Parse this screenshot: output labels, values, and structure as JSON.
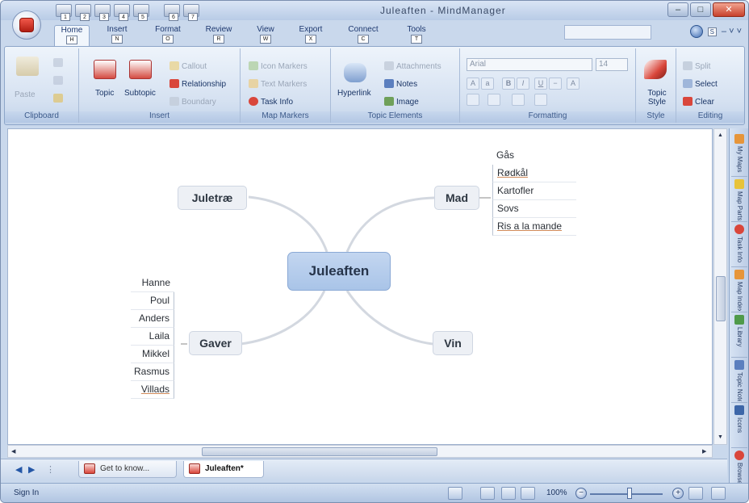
{
  "window": {
    "title": "Juleaften - MindManager",
    "controls": [
      "–",
      "□",
      "✕"
    ]
  },
  "quick_access": {
    "keys": [
      "1",
      "2",
      "3",
      "4",
      "5",
      "6",
      "7"
    ]
  },
  "ribbon_tabs": [
    {
      "label": "Home",
      "key": "H",
      "active": true
    },
    {
      "label": "Insert",
      "key": "N"
    },
    {
      "label": "Format",
      "key": "O"
    },
    {
      "label": "Review",
      "key": "R"
    },
    {
      "label": "View",
      "key": "W"
    },
    {
      "label": "Export",
      "key": "X"
    },
    {
      "label": "Connect",
      "key": "C"
    },
    {
      "label": "Tools",
      "key": "T"
    }
  ],
  "help_key": "S",
  "ribbon": {
    "clipboard": {
      "label": "Clipboard",
      "paste": "Paste"
    },
    "insert": {
      "label": "Insert",
      "topic": "Topic",
      "subtopic": "Subtopic",
      "callout": "Callout",
      "relationship": "Relationship",
      "boundary": "Boundary"
    },
    "map_markers": {
      "label": "Map Markers",
      "icon_markers": "Icon Markers",
      "text_markers": "Text Markers",
      "task_info": "Task Info"
    },
    "topic_elements": {
      "label": "Topic Elements",
      "hyperlink": "Hyperlink",
      "attachments": "Attachments",
      "notes": "Notes",
      "image": "Image"
    },
    "formatting": {
      "label": "Formatting",
      "font": "Arial",
      "size": "14"
    },
    "style": {
      "label": "Style",
      "topic_style": "Topic Style"
    },
    "editing": {
      "label": "Editing",
      "split": "Split",
      "select": "Select",
      "clear": "Clear"
    }
  },
  "mindmap": {
    "central": "Juleaften",
    "topics": {
      "juletrae": "Juletræ",
      "mad": "Mad",
      "gaver": "Gaver",
      "vin": "Vin"
    },
    "mad_items": [
      "Gås",
      "Rødkål",
      "Kartofler",
      "Sovs",
      "Ris a la mande"
    ],
    "gaver_items": [
      "Hanne",
      "Poul",
      "Anders",
      "Laila",
      "Mikkel",
      "Rasmus",
      "Villads"
    ]
  },
  "side_tabs": [
    "My Maps",
    "Map Parts",
    "Task Info",
    "Map Index",
    "Library",
    "Topic Notes",
    "Icons",
    "Browser"
  ],
  "doc_tabs": [
    {
      "label": "Get to know..."
    },
    {
      "label": "Juleaften*",
      "active": true
    }
  ],
  "status": {
    "sign_in": "Sign In",
    "zoom": "100%",
    "zoom_level_percent": 100
  },
  "colors": {
    "accent": "#a9c4e8",
    "topic_fill": "#edf0f5",
    "ribbon": "#d5e1f1"
  }
}
